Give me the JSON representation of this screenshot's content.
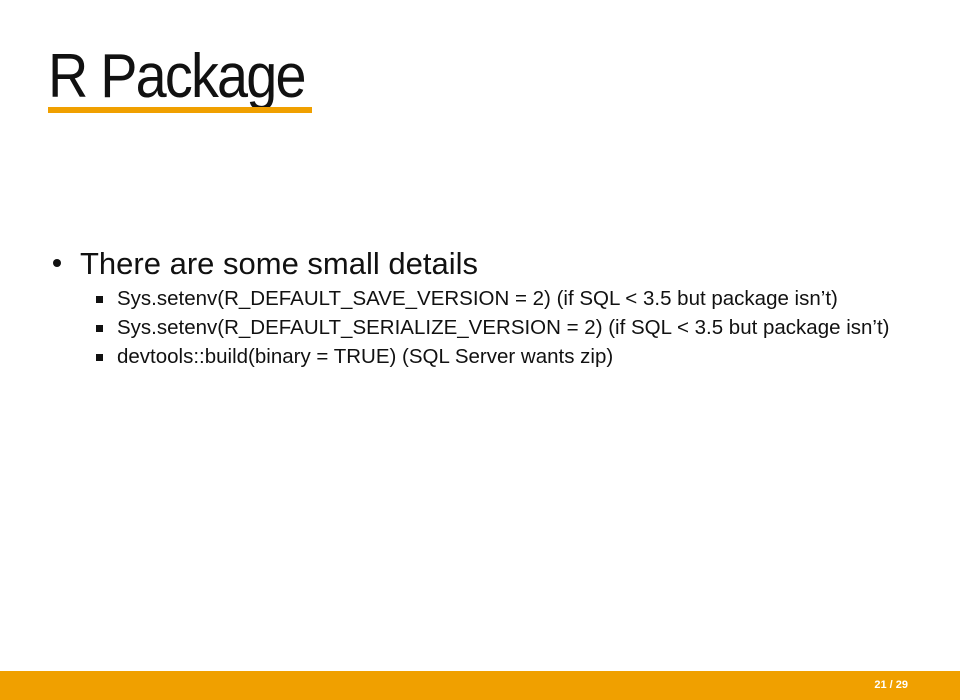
{
  "slide": {
    "title": "R Package",
    "bullets": [
      {
        "text": "There are some small details",
        "sub_bullets": [
          "Sys.setenv(R_DEFAULT_SAVE_VERSION = 2) (if SQL < 3.5 but package isn’t)",
          "Sys.setenv(R_DEFAULT_SERIALIZE_VERSION = 2) (if SQL < 3.5 but package isn’t)",
          "devtools::build(binary = TRUE) (SQL Server wants zip)"
        ]
      }
    ]
  },
  "footer": {
    "page_number": "21 / 29"
  },
  "colors": {
    "accent": "#f0a000",
    "text": "#111111",
    "background": "#ffffff"
  }
}
